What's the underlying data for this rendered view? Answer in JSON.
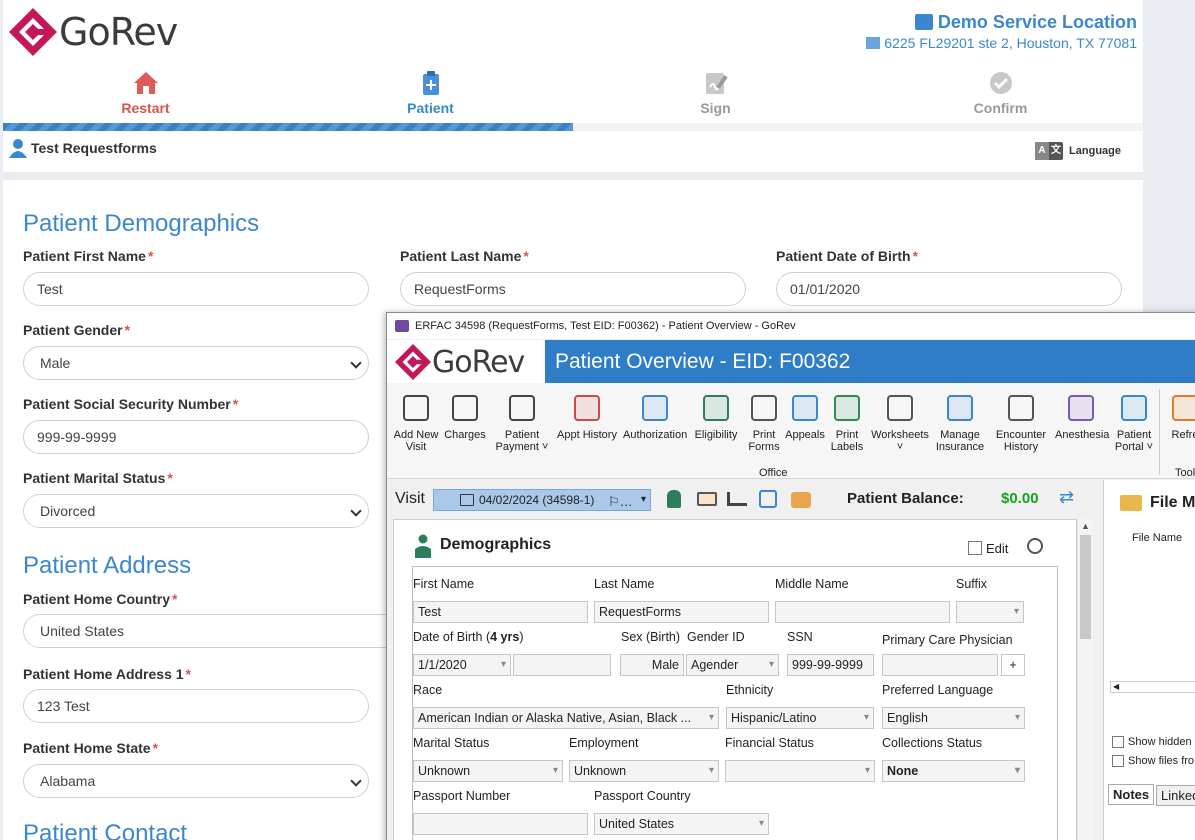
{
  "app": {
    "brand": "GoRev",
    "location_name": "Demo Service Location",
    "location_address": "6225 FL29201 ste 2, Houston, TX 77081"
  },
  "steps": [
    {
      "label": "Restart",
      "color": "#d9534f"
    },
    {
      "label": "Patient",
      "color": "#3b87cf"
    },
    {
      "label": "Sign",
      "color": "#999999"
    },
    {
      "label": "Confirm",
      "color": "#999999"
    }
  ],
  "progress": 0.5,
  "user": {
    "name": "Test Requestforms"
  },
  "language": {
    "label": "Language",
    "a": "A",
    "b": "文"
  },
  "form": {
    "demographics_title": "Patient Demographics",
    "first_name_label": "Patient First Name",
    "first_name_value": "Test",
    "last_name_label": "Patient Last Name",
    "last_name_value": "RequestForms",
    "dob_label": "Patient Date of Birth",
    "dob_value": "01/01/2020",
    "gender_label": "Patient Gender",
    "gender_value": "Male",
    "ssn_label": "Patient Social Security Number",
    "ssn_value": "999-99-9999",
    "marital_label": "Patient Marital Status",
    "marital_value": "Divorced",
    "address_title": "Patient Address",
    "country_label": "Patient Home Country",
    "country_value": "United States",
    "address1_label": "Patient Home Address 1",
    "address1_value": "123 Test",
    "state_label": "Patient Home State",
    "state_value": "Alabama",
    "contact_title": "Patient Contact",
    "required_mark": "*"
  },
  "window": {
    "title": "ERFAC 34598 (RequestForms, Test EID: F00362) - Patient Overview - GoRev",
    "banner": "Patient Overview - EID: F00362",
    "ribbon": [
      {
        "label": "Add New\nVisit",
        "icon": "bed-plus-icon"
      },
      {
        "label": "Charges",
        "icon": "barcode-icon"
      },
      {
        "label": "Patient\nPayment ˅",
        "icon": "payment-hand-icon"
      },
      {
        "label": "Appt History",
        "icon": "calendar-icon"
      },
      {
        "label": "Authorization",
        "icon": "shield-clipboard-icon"
      },
      {
        "label": "Eligibility",
        "icon": "person-check-icon"
      },
      {
        "label": "Print\nForms",
        "icon": "printer-icon"
      },
      {
        "label": "Appeals",
        "icon": "documents-icon"
      },
      {
        "label": "Print\nLabels",
        "icon": "tag-icon"
      },
      {
        "label": "Worksheets\n˅",
        "icon": "worksheet-icon"
      },
      {
        "label": "Manage\nInsurance",
        "icon": "insurance-icon"
      },
      {
        "label": "Encounter\nHistory",
        "icon": "clock-calendar-icon"
      },
      {
        "label": "Anesthesia",
        "icon": "syringe-icon"
      },
      {
        "label": "Patient\nPortal ˅",
        "icon": "globe-gear-icon"
      },
      {
        "label": "Refre",
        "icon": "refresh-icon"
      }
    ],
    "group_office": "Office",
    "group_tools": "Tool",
    "visit_label": "Visit",
    "visit_value": "04/02/2024 (34598-1)",
    "balance_label": "Patient Balance:",
    "balance_value": "$0.00",
    "demographics_title": "Demographics",
    "edit_label": "Edit",
    "fields": {
      "first_name": {
        "label": "First Name",
        "value": "Test"
      },
      "last_name": {
        "label": "Last Name",
        "value": "RequestForms"
      },
      "middle_name": {
        "label": "Middle Name",
        "value": ""
      },
      "suffix": {
        "label": "Suffix",
        "value": ""
      },
      "dob": {
        "label": "Date of Birth",
        "age": "4 yrs",
        "value": "1/1/2020"
      },
      "sex": {
        "label": "Sex (Birth)",
        "value": "Male"
      },
      "gender_id": {
        "label": "Gender ID",
        "value": "Agender"
      },
      "ssn": {
        "label": "SSN",
        "value": "999-99-9999"
      },
      "pcp": {
        "label": "Primary Care Physician",
        "value": ""
      },
      "race": {
        "label": "Race",
        "value": "American Indian or Alaska Native, Asian, Black ..."
      },
      "ethnicity": {
        "label": "Ethnicity",
        "value": "Hispanic/Latino"
      },
      "language": {
        "label": "Preferred Language",
        "value": "English"
      },
      "marital": {
        "label": "Marital Status",
        "value": "Unknown"
      },
      "employment": {
        "label": "Employment",
        "value": "Unknown"
      },
      "financial": {
        "label": "Financial Status",
        "value": ""
      },
      "collections": {
        "label": "Collections Status",
        "value": "None"
      },
      "passport_number": {
        "label": "Passport Number",
        "value": ""
      },
      "passport_country": {
        "label": "Passport Country",
        "value": "United States"
      }
    },
    "file_manager": {
      "title": "File Ma",
      "col": "File Name",
      "show_hidden": "Show hidden",
      "show_files": "Show files fro",
      "tab_notes": "Notes",
      "tab_linked": "Linked"
    }
  },
  "colors": {
    "accent": "#3b87cf",
    "brand": "#c2185b",
    "balance": "#15a520",
    "banner": "#2f7cc7"
  }
}
